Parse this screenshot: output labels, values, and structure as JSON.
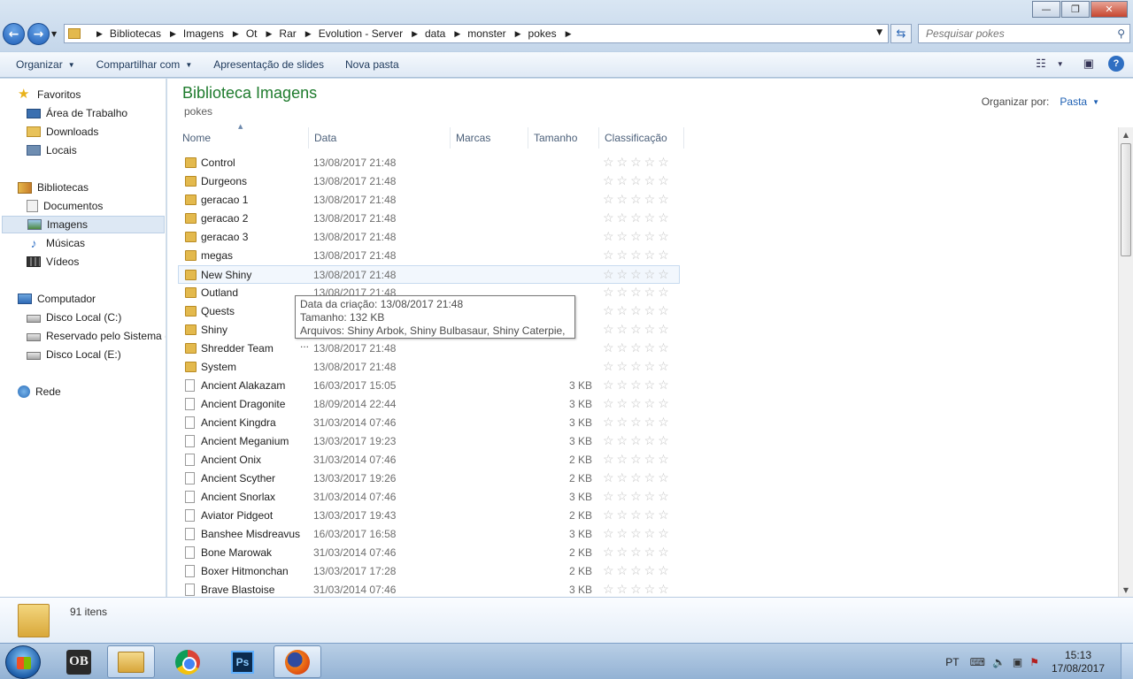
{
  "window": {
    "controls": {
      "minimize": "—",
      "maximize": "❐",
      "close": "✕"
    }
  },
  "address": {
    "crumbs": [
      "Bibliotecas",
      "Imagens",
      "Ot",
      "Rar",
      "Evolution - Server",
      "data",
      "monster",
      "pokes"
    ]
  },
  "search": {
    "placeholder": "Pesquisar pokes"
  },
  "toolbar": {
    "organize": "Organizar",
    "share": "Compartilhar com",
    "slideshow": "Apresentação de slides",
    "new_folder": "Nova pasta"
  },
  "nav": {
    "favorites": "Favoritos",
    "desktop": "Área de Trabalho",
    "downloads": "Downloads",
    "places": "Locais",
    "libraries": "Bibliotecas",
    "documents": "Documentos",
    "images": "Imagens",
    "music": "Músicas",
    "videos": "Vídeos",
    "computer": "Computador",
    "disk_c": "Disco Local (C:)",
    "reserved": "Reservado pelo Sistema (D:)",
    "disk_e": "Disco Local (E:)",
    "network": "Rede"
  },
  "library": {
    "title": "Biblioteca Imagens",
    "subtitle": "pokes",
    "arrange_label": "Organizar por:",
    "arrange_value": "Pasta"
  },
  "columns": {
    "name": "Nome",
    "date": "Data",
    "tags": "Marcas",
    "size": "Tamanho",
    "rating": "Classificação"
  },
  "rows": [
    {
      "name": "Control",
      "date": "13/08/2017 21:48",
      "size": "",
      "type": "folder"
    },
    {
      "name": "Durgeons",
      "date": "13/08/2017 21:48",
      "size": "",
      "type": "folder"
    },
    {
      "name": "geracao 1",
      "date": "13/08/2017 21:48",
      "size": "",
      "type": "folder"
    },
    {
      "name": "geracao 2",
      "date": "13/08/2017 21:48",
      "size": "",
      "type": "folder"
    },
    {
      "name": "geracao 3",
      "date": "13/08/2017 21:48",
      "size": "",
      "type": "folder"
    },
    {
      "name": "megas",
      "date": "13/08/2017 21:48",
      "size": "",
      "type": "folder"
    },
    {
      "name": "New Shiny",
      "date": "13/08/2017 21:48",
      "size": "",
      "type": "folder"
    },
    {
      "name": "Outland",
      "date": "13/08/2017 21:48",
      "size": "",
      "type": "folder"
    },
    {
      "name": "Quests",
      "date": "",
      "size": "",
      "type": "folder"
    },
    {
      "name": "Shiny",
      "date": "",
      "size": "",
      "type": "folder"
    },
    {
      "name": "Shredder Team",
      "date": "13/08/2017 21:48",
      "size": "",
      "type": "folder"
    },
    {
      "name": "System",
      "date": "13/08/2017 21:48",
      "size": "",
      "type": "folder"
    },
    {
      "name": "Ancient Alakazam",
      "date": "16/03/2017 15:05",
      "size": "3 KB",
      "type": "file"
    },
    {
      "name": "Ancient Dragonite",
      "date": "18/09/2014 22:44",
      "size": "3 KB",
      "type": "file"
    },
    {
      "name": "Ancient Kingdra",
      "date": "31/03/2014 07:46",
      "size": "3 KB",
      "type": "file"
    },
    {
      "name": "Ancient Meganium",
      "date": "13/03/2017 19:23",
      "size": "3 KB",
      "type": "file"
    },
    {
      "name": "Ancient Onix",
      "date": "31/03/2014 07:46",
      "size": "2 KB",
      "type": "file"
    },
    {
      "name": "Ancient Scyther",
      "date": "13/03/2017 19:26",
      "size": "2 KB",
      "type": "file"
    },
    {
      "name": "Ancient Snorlax",
      "date": "31/03/2014 07:46",
      "size": "3 KB",
      "type": "file"
    },
    {
      "name": "Aviator Pidgeot",
      "date": "13/03/2017 19:43",
      "size": "2 KB",
      "type": "file"
    },
    {
      "name": "Banshee Misdreavus",
      "date": "16/03/2017 16:58",
      "size": "3 KB",
      "type": "file"
    },
    {
      "name": "Bone Marowak",
      "date": "31/03/2014 07:46",
      "size": "2 KB",
      "type": "file"
    },
    {
      "name": "Boxer Hitmonchan",
      "date": "13/03/2017 17:28",
      "size": "2 KB",
      "type": "file"
    },
    {
      "name": "Brave Blastoise",
      "date": "31/03/2014 07:46",
      "size": "3 KB",
      "type": "file"
    }
  ],
  "rating_stars": "☆☆☆☆☆",
  "tooltip": {
    "created": "Data da criação: 13/08/2017 21:48",
    "size": "Tamanho: 132 KB",
    "files": "Arquivos: Shiny Arbok, Shiny Bulbasaur, Shiny Caterpie, ..."
  },
  "details": {
    "count": "91 itens"
  },
  "taskbar": {
    "lang": "PT",
    "time": "15:13",
    "date": "17/08/2017",
    "ps_label": "Ps",
    "ob_label": "OB"
  },
  "colors": {
    "title_green": "#1e7b2d",
    "link_blue": "#1d5fb3"
  }
}
